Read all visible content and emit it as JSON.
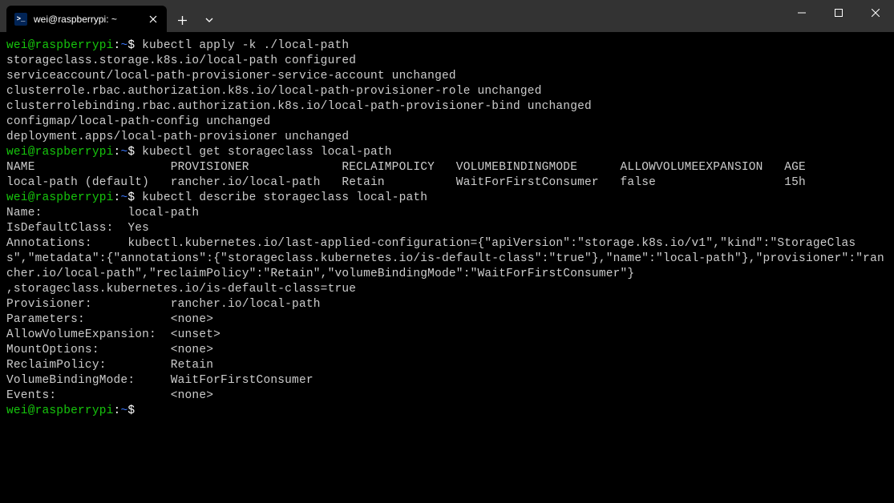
{
  "titlebar": {
    "tab_title": "wei@raspberrypi: ~",
    "tab_icon_glyph": ">_"
  },
  "prompt": {
    "user_host": "wei@raspberrypi",
    "sep": ":",
    "path": "~",
    "dollar": "$"
  },
  "commands": {
    "cmd1": " kubectl apply -k ./local-path",
    "cmd2": " kubectl get storageclass local-path",
    "cmd3": " kubectl describe storageclass local-path"
  },
  "output1": {
    "l1": "storageclass.storage.k8s.io/local-path configured",
    "l2": "serviceaccount/local-path-provisioner-service-account unchanged",
    "l3": "clusterrole.rbac.authorization.k8s.io/local-path-provisioner-role unchanged",
    "l4": "clusterrolebinding.rbac.authorization.k8s.io/local-path-provisioner-bind unchanged",
    "l5": "configmap/local-path-config unchanged",
    "l6": "deployment.apps/local-path-provisioner unchanged"
  },
  "output2": {
    "header": "NAME                   PROVISIONER             RECLAIMPOLICY   VOLUMEBINDINGMODE      ALLOWVOLUMEEXPANSION   AGE",
    "row": "local-path (default)   rancher.io/local-path   Retain          WaitForFirstConsumer   false                  15h"
  },
  "output3": {
    "l1": "Name:            local-path",
    "l2": "IsDefaultClass:  Yes",
    "l3": "Annotations:     kubectl.kubernetes.io/last-applied-configuration={\"apiVersion\":\"storage.k8s.io/v1\",\"kind\":\"StorageClass\",\"metadata\":{\"annotations\":{\"storageclass.kubernetes.io/is-default-class\":\"true\"},\"name\":\"local-path\"},\"provisioner\":\"rancher.io/local-path\",\"reclaimPolicy\":\"Retain\",\"volumeBindingMode\":\"WaitForFirstConsumer\"}",
    "l4": ",storageclass.kubernetes.io/is-default-class=true",
    "l5": "Provisioner:           rancher.io/local-path",
    "l6": "Parameters:            <none>",
    "l7": "AllowVolumeExpansion:  <unset>",
    "l8": "MountOptions:          <none>",
    "l9": "ReclaimPolicy:         Retain",
    "l10": "VolumeBindingMode:     WaitForFirstConsumer",
    "l11": "Events:                <none>"
  }
}
